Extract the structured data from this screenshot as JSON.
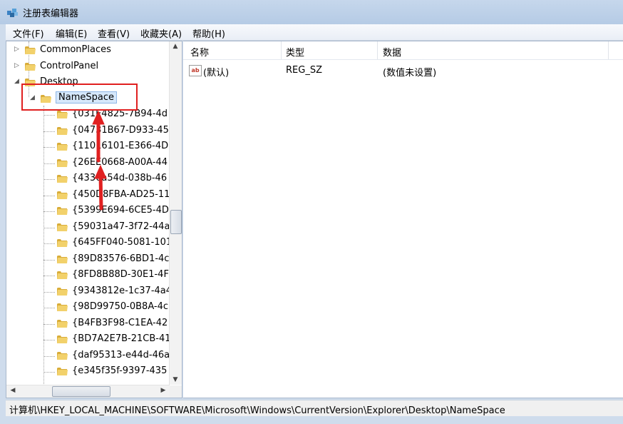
{
  "window": {
    "title": "注册表编辑器",
    "app_icon": "regedit-icon"
  },
  "menu": {
    "file": "文件(F)",
    "edit": "编辑(E)",
    "view": "查看(V)",
    "favorites": "收藏夹(A)",
    "help": "帮助(H)"
  },
  "tree": {
    "items": [
      {
        "label": "CommonPlaces",
        "state": "collapsed"
      },
      {
        "label": "ControlPanel",
        "state": "collapsed"
      },
      {
        "label": "Desktop",
        "state": "expanded"
      },
      {
        "label": "NameSpace",
        "state": "expanded",
        "selected": true
      },
      {
        "label": "{031E4825-7B94-4d"
      },
      {
        "label": "{04731B67-D933-45"
      },
      {
        "label": "{11016101-E366-4D"
      },
      {
        "label": "{26EE0668-A00A-44"
      },
      {
        "label": "{4336a54d-038b-46"
      },
      {
        "label": "{450D8FBA-AD25-11"
      },
      {
        "label": "{5399E694-6CE5-4D"
      },
      {
        "label": "{59031a47-3f72-44a"
      },
      {
        "label": "{645FF040-5081-101"
      },
      {
        "label": "{89D83576-6BD1-4c"
      },
      {
        "label": "{8FD8B88D-30E1-4F"
      },
      {
        "label": "{9343812e-1c37-4a4"
      },
      {
        "label": "{98D99750-0B8A-4c"
      },
      {
        "label": "{B4FB3F98-C1EA-42"
      },
      {
        "label": "{BD7A2E7B-21CB-41"
      },
      {
        "label": "{daf95313-e44d-46a"
      },
      {
        "label": "{e345f35f-9397-435"
      }
    ]
  },
  "list": {
    "headers": {
      "name": "名称",
      "type": "类型",
      "data": "数据"
    },
    "rows": [
      {
        "name": "(默认)",
        "type": "REG_SZ",
        "data": "(数值未设置)",
        "icon": "string-value-icon"
      }
    ]
  },
  "status": {
    "path": "计算机\\HKEY_LOCAL_MACHINE\\SOFTWARE\\Microsoft\\Windows\\CurrentVersion\\Explorer\\Desktop\\NameSpace"
  },
  "colors": {
    "annotation_red": "#e02020",
    "folder_yellow": "#e8c25a"
  }
}
